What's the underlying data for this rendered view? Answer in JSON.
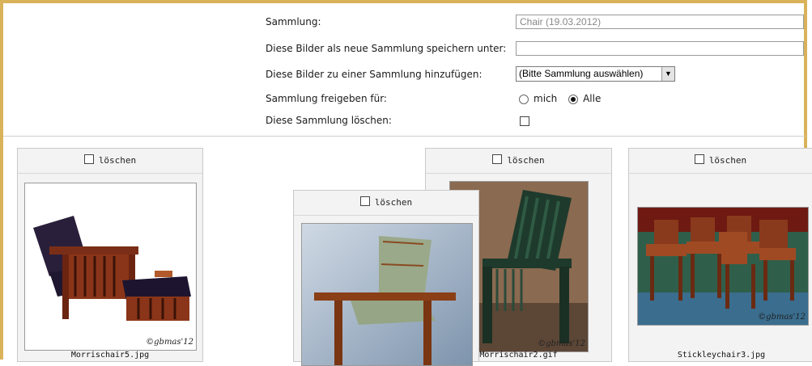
{
  "form": {
    "collection_label": "Sammlung:",
    "collection_value": "Chair (19.03.2012)",
    "save_as_label": "Diese Bilder als neue Sammlung speichern unter:",
    "save_as_value": "",
    "add_to_label": "Diese Bilder zu einer Sammlung hinzufügen:",
    "add_to_selected": "(Bitte Sammlung auswählen)",
    "share_label": "Sammlung freigeben für:",
    "share_option_me": "mich",
    "share_option_all": "Alle",
    "share_selected": "Alle",
    "delete_label": "Diese Sammlung löschen:"
  },
  "images": [
    {
      "delete_label": "löschen",
      "filename": "Morrischair5.jpg",
      "watermark": "©gbmas'12"
    },
    {
      "delete_label": "löschen",
      "filename": "",
      "watermark": ""
    },
    {
      "delete_label": "löschen",
      "filename": "Morrischair2.gif",
      "watermark": "©gbmas'12"
    },
    {
      "delete_label": "löschen",
      "filename": "Stickleychair3.jpg",
      "watermark": "©gbmas'12"
    }
  ],
  "colors": {
    "frame": "#d9b25a",
    "card_bg": "#f3f3f3"
  }
}
